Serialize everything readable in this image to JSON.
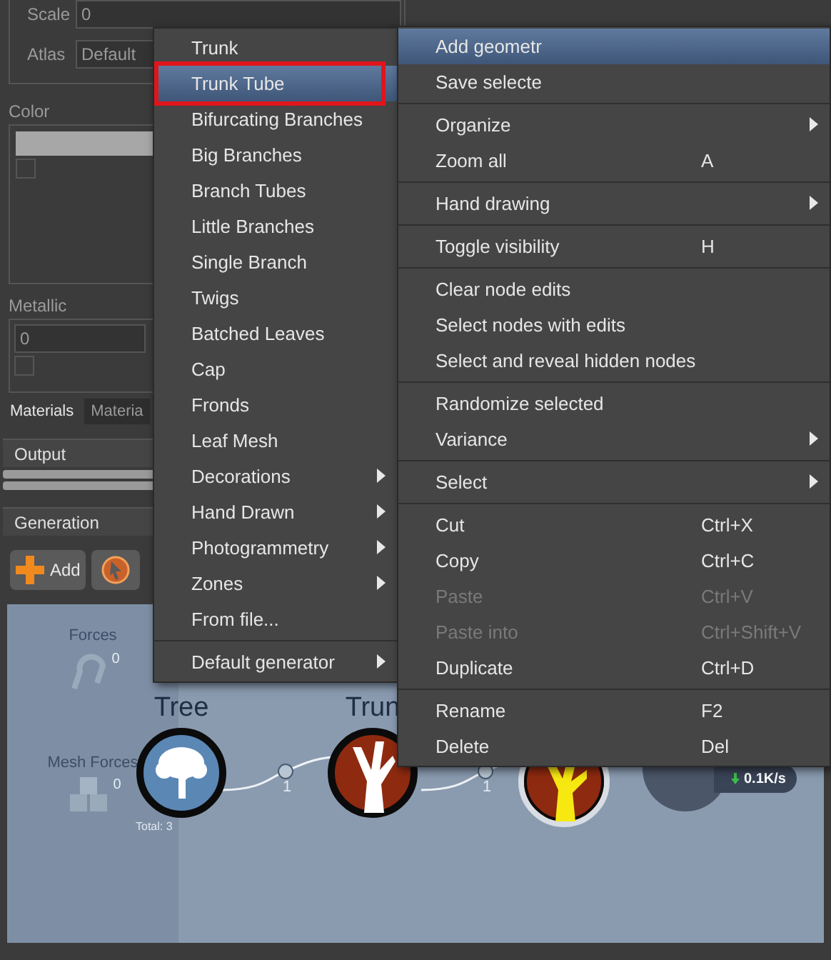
{
  "properties": {
    "scale": {
      "label": "Scale",
      "value": "0"
    },
    "atlas": {
      "label": "Atlas",
      "value": "Default"
    },
    "color": {
      "label": "Color",
      "checked": false
    },
    "metallic": {
      "label": "Metallic",
      "value": "0",
      "checked": false
    }
  },
  "tabs": [
    {
      "label": "Materials",
      "selected": true
    },
    {
      "label": "Materia",
      "selected": false
    }
  ],
  "sections": [
    {
      "title": "Output"
    },
    {
      "title": "Generation"
    }
  ],
  "toolbar": {
    "add_button": "Add"
  },
  "canvas": {
    "side": [
      {
        "label": "Forces",
        "count": "0",
        "kind": "forces"
      },
      {
        "label": "Mesh Forces",
        "count": "0",
        "kind": "mesh"
      }
    ],
    "nodes": [
      {
        "label": "Tree",
        "kind": "tree",
        "footnote": "Total: 3"
      },
      {
        "label": "Trun",
        "kind": "trunk"
      },
      {
        "kind": "branch"
      }
    ],
    "links": [
      "1",
      "1"
    ],
    "speed": "0.1K/s"
  },
  "generator_menu": {
    "sections": [
      [
        {
          "label": "Trunk",
          "selected": false,
          "submenu": false
        },
        {
          "label": "Trunk Tube",
          "selected": true,
          "submenu": false
        },
        {
          "label": "Bifurcating Branches",
          "selected": false,
          "submenu": false
        },
        {
          "label": "Big Branches",
          "selected": false,
          "submenu": false
        },
        {
          "label": "Branch Tubes",
          "selected": false,
          "submenu": false
        },
        {
          "label": "Little Branches",
          "selected": false,
          "submenu": false
        },
        {
          "label": "Single Branch",
          "selected": false,
          "submenu": false
        },
        {
          "label": "Twigs",
          "selected": false,
          "submenu": false
        },
        {
          "label": "Batched Leaves",
          "selected": false,
          "submenu": false
        },
        {
          "label": "Cap",
          "selected": false,
          "submenu": false
        },
        {
          "label": "Fronds",
          "selected": false,
          "submenu": false
        },
        {
          "label": "Leaf Mesh",
          "selected": false,
          "submenu": false
        },
        {
          "label": "Decorations",
          "selected": false,
          "submenu": true
        },
        {
          "label": "Hand Drawn",
          "selected": false,
          "submenu": true
        },
        {
          "label": "Photogrammetry",
          "selected": false,
          "submenu": true
        },
        {
          "label": "Zones",
          "selected": false,
          "submenu": true
        },
        {
          "label": "From file...",
          "selected": false,
          "submenu": false
        }
      ],
      [
        {
          "label": "Default generator",
          "selected": false,
          "submenu": true
        }
      ]
    ]
  },
  "context_menu": {
    "sections": [
      [
        {
          "label": "Add geometr",
          "selected": true,
          "submenu": false,
          "disabled": false
        },
        {
          "label": "Save selecte",
          "selected": false,
          "submenu": false,
          "disabled": false
        }
      ],
      [
        {
          "label": "Organize",
          "selected": false,
          "submenu": true,
          "disabled": false
        },
        {
          "label": "Zoom all",
          "shortcut": "A",
          "selected": false,
          "submenu": false,
          "disabled": false
        }
      ],
      [
        {
          "label": "Hand drawing",
          "selected": false,
          "submenu": true,
          "disabled": false
        }
      ],
      [
        {
          "label": "Toggle visibility",
          "shortcut": "H",
          "selected": false,
          "submenu": false,
          "disabled": false
        }
      ],
      [
        {
          "label": "Clear node edits",
          "selected": false,
          "submenu": false,
          "disabled": false
        },
        {
          "label": "Select nodes with edits",
          "selected": false,
          "submenu": false,
          "disabled": false
        },
        {
          "label": "Select and reveal hidden nodes",
          "selected": false,
          "submenu": false,
          "disabled": false
        }
      ],
      [
        {
          "label": "Randomize selected",
          "selected": false,
          "submenu": false,
          "disabled": false
        },
        {
          "label": "Variance",
          "selected": false,
          "submenu": true,
          "disabled": false
        }
      ],
      [
        {
          "label": "Select",
          "selected": false,
          "submenu": true,
          "disabled": false
        }
      ],
      [
        {
          "label": "Cut",
          "shortcut": "Ctrl+X",
          "selected": false,
          "submenu": false,
          "disabled": false
        },
        {
          "label": "Copy",
          "shortcut": "Ctrl+C",
          "selected": false,
          "submenu": false,
          "disabled": false
        },
        {
          "label": "Paste",
          "shortcut": "Ctrl+V",
          "selected": false,
          "submenu": false,
          "disabled": true
        },
        {
          "label": "Paste into",
          "shortcut": "Ctrl+Shift+V",
          "selected": false,
          "submenu": false,
          "disabled": true
        },
        {
          "label": "Duplicate",
          "shortcut": "Ctrl+D",
          "selected": false,
          "submenu": false,
          "disabled": false
        }
      ],
      [
        {
          "label": "Rename",
          "shortcut": "F2",
          "selected": false,
          "submenu": false,
          "disabled": false
        },
        {
          "label": "Delete",
          "shortcut": "Del",
          "selected": false,
          "submenu": false,
          "disabled": false
        }
      ]
    ]
  }
}
